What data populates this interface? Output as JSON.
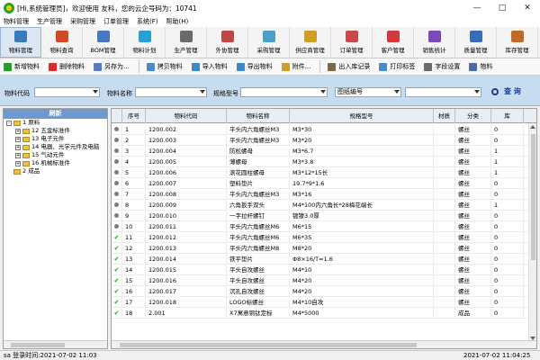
{
  "window": {
    "title": "[Hi,系统管理员]，欢迎使用 友科，您的云企号码为：10741"
  },
  "menu": [
    "物料管理",
    "生产管理",
    "采购管理",
    "订单管理",
    "系统(F)",
    "帮助(H)"
  ],
  "modules": [
    {
      "label": "物料管理",
      "icon": "material-icon",
      "color": "#3a7ab8"
    },
    {
      "label": "物料查询",
      "icon": "car-icon",
      "color": "#d04a2a"
    },
    {
      "label": "BOM管理",
      "icon": "bom-grid-icon",
      "color": "#4a78c0"
    },
    {
      "label": "物料计划",
      "icon": "calendar-icon",
      "color": "#2a9fd6"
    },
    {
      "label": "生产管理",
      "icon": "production-icon",
      "color": "#6a6a6a"
    },
    {
      "label": "外协管理",
      "icon": "outsource-icon",
      "color": "#c04848"
    },
    {
      "label": "采购管理",
      "icon": "purchase-icon",
      "color": "#4aa0c8"
    },
    {
      "label": "供应商管理",
      "icon": "supplier-icon",
      "color": "#d09c2a"
    },
    {
      "label": "订单管理",
      "icon": "order-icon",
      "color": "#c84a4a"
    },
    {
      "label": "客户管理",
      "icon": "customer-icon",
      "color": "#d03a3a"
    },
    {
      "label": "销售统计",
      "icon": "chart-icon",
      "color": "#7a4ab8"
    },
    {
      "label": "质量管理",
      "icon": "quality-icon",
      "color": "#3a6ab8"
    },
    {
      "label": "库存管理",
      "icon": "warehouse-icon",
      "color": "#c06a2a"
    }
  ],
  "toolbar": [
    {
      "label": "新增物料",
      "icon": "add-icon",
      "color": "#2a9a2a"
    },
    {
      "label": "删除物料",
      "icon": "delete-icon",
      "color": "#d03030"
    },
    {
      "label": "另存为...",
      "icon": "save-as-icon",
      "color": "#5a7ab8"
    },
    {
      "label": "拷贝物料",
      "icon": "copy-icon",
      "color": "#4a8ac8"
    },
    {
      "label": "导入物料",
      "icon": "import-icon",
      "color": "#3a8ac8"
    },
    {
      "label": "导出物料",
      "icon": "export-icon",
      "color": "#3a8ac8"
    },
    {
      "label": "附件...",
      "icon": "attachment-icon",
      "color": "#d09c2a"
    },
    {
      "label": "出入库记录",
      "icon": "stock-record-icon",
      "color": "#7a6a4a"
    },
    {
      "label": "打印标签",
      "icon": "print-icon",
      "color": "#4a8ac8"
    },
    {
      "label": "字段设置",
      "icon": "field-settings-icon",
      "color": "#6a6a6a"
    },
    {
      "label": "物料",
      "icon": "material-icon",
      "color": "#4a6aa8"
    }
  ],
  "search": {
    "code_label": "物料代码",
    "name_label": "物料名称",
    "spec_label": "规格型号",
    "spec_value": "",
    "code_value": "",
    "name_value": "",
    "type_value": "图纸编号",
    "extra_value": "",
    "query_label": "查 询"
  },
  "tree": {
    "header": "刷新",
    "nodes": [
      {
        "text": "1 原料",
        "expander": "-",
        "indent": 0
      },
      {
        "text": "12 五金标准件",
        "expander": "+",
        "indent": 1
      },
      {
        "text": "13 电子元件",
        "expander": "+",
        "indent": 1
      },
      {
        "text": "14 电器、光学元件及电脑",
        "expander": "+",
        "indent": 1
      },
      {
        "text": "15 气动元件",
        "expander": "+",
        "indent": 1
      },
      {
        "text": "16 机械标准件",
        "expander": "+",
        "indent": 1
      },
      {
        "text": "2 成品",
        "expander": "",
        "indent": 0
      }
    ]
  },
  "grid": {
    "columns": [
      "",
      "序号",
      "物料代码",
      "物料名称",
      "规格型号",
      "材质",
      "分类",
      "库"
    ],
    "rows": [
      {
        "status": "dot",
        "seq": "1",
        "code": "1200.002",
        "name": "平头内六角螺丝M3",
        "spec": "M3*30",
        "mat": "",
        "cat": "螺丝",
        "qty": "0"
      },
      {
        "status": "dot",
        "seq": "2",
        "code": "1200.003",
        "name": "平头内六角螺丝M3",
        "spec": "M3*20",
        "mat": "",
        "cat": "螺丝",
        "qty": "0"
      },
      {
        "status": "dot",
        "seq": "3",
        "code": "1200.004",
        "name": "防松螺母",
        "spec": "M3*6.7",
        "mat": "",
        "cat": "螺丝",
        "qty": "1"
      },
      {
        "status": "dot",
        "seq": "4",
        "code": "1200.005",
        "name": "薄螺母",
        "spec": "M3*3.8",
        "mat": "",
        "cat": "螺丝",
        "qty": "1"
      },
      {
        "status": "dot",
        "seq": "5",
        "code": "1200.006",
        "name": "滚花圆柱螺母",
        "spec": "M3*12*15长",
        "mat": "",
        "cat": "螺丝",
        "qty": "1"
      },
      {
        "status": "dot",
        "seq": "6",
        "code": "1200.007",
        "name": "塑料垫片",
        "spec": "19.7*9*1.6",
        "mat": "",
        "cat": "螺丝",
        "qty": "0"
      },
      {
        "status": "dot",
        "seq": "7",
        "code": "1200.008",
        "name": "平头内六角螺丝M3",
        "spec": "M3*16",
        "mat": "",
        "cat": "螺丝",
        "qty": "0"
      },
      {
        "status": "dot",
        "seq": "8",
        "code": "1200.009",
        "name": "六角扳手双头",
        "spec": "M4*100内六角长*28梅花端长",
        "mat": "",
        "cat": "螺丝",
        "qty": "1"
      },
      {
        "status": "dot",
        "seq": "9",
        "code": "1200.010",
        "name": "一字拉杆螺钉",
        "spec": "镀镍3.0厚",
        "mat": "",
        "cat": "螺丝",
        "qty": "0"
      },
      {
        "status": "dot",
        "seq": "10",
        "code": "1200.011",
        "name": "平头内六角螺丝M6",
        "spec": "M6*15",
        "mat": "",
        "cat": "螺丝",
        "qty": "0"
      },
      {
        "status": "check",
        "seq": "11",
        "code": "1200.012",
        "name": "平头内六角螺丝M6",
        "spec": "M6*35",
        "mat": "",
        "cat": "螺丝",
        "qty": "0"
      },
      {
        "status": "check",
        "seq": "12",
        "code": "1200.013",
        "name": "平头内六角螺丝M8",
        "spec": "M8*20",
        "mat": "",
        "cat": "螺丝",
        "qty": "0"
      },
      {
        "status": "check",
        "seq": "13",
        "code": "1200.014",
        "name": "铁平垫片",
        "spec": "Φ8×16/T=1.6",
        "mat": "",
        "cat": "螺丝",
        "qty": "0"
      },
      {
        "status": "check",
        "seq": "14",
        "code": "1200.015",
        "name": "平头自攻螺丝",
        "spec": "M4*10",
        "mat": "",
        "cat": "螺丝",
        "qty": "0"
      },
      {
        "status": "check",
        "seq": "15",
        "code": "1200.016",
        "name": "平头自攻螺丝",
        "spec": "M4*20",
        "mat": "",
        "cat": "螺丝",
        "qty": "0"
      },
      {
        "status": "check",
        "seq": "16",
        "code": "1200.017",
        "name": "沉孔自攻螺丝",
        "spec": "M4*20",
        "mat": "",
        "cat": "螺丝",
        "qty": "0"
      },
      {
        "status": "check",
        "seq": "17",
        "code": "1200.018",
        "name": "LOGO标螺丝",
        "spec": "M4*10自攻",
        "mat": "",
        "cat": "螺丝",
        "qty": "0"
      },
      {
        "status": "check",
        "seq": "18",
        "code": "2.001",
        "name": "X7寓意铜钛定标",
        "spec": "M4*5000",
        "mat": "",
        "cat": "成品",
        "qty": "0"
      }
    ]
  },
  "status": {
    "left": "sa 登录时间:2021-07-02 11:03",
    "right": "2021-07-02 11:04:25"
  }
}
